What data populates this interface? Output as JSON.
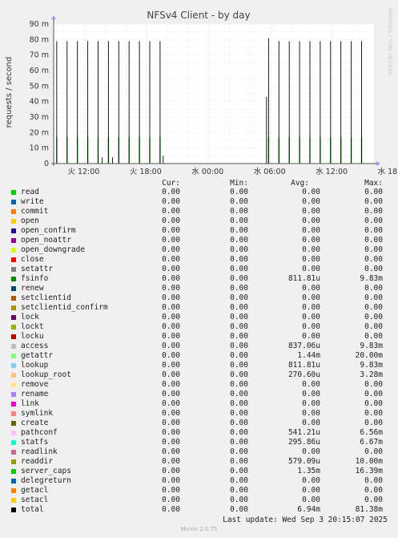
{
  "chart_data": {
    "type": "line",
    "title": "NFSv4 Client - by day",
    "ylabel": "requests / second",
    "side_label": "RRDTOOL / TOBI OETIKER",
    "ylim": [
      0,
      90
    ],
    "y_ticks": [
      "0",
      "10 m",
      "20 m",
      "30 m",
      "40 m",
      "50 m",
      "60 m",
      "70 m",
      "80 m",
      "90 m"
    ],
    "x_ticks": [
      "火 12:00",
      "火 18:00",
      "水 00:00",
      "水 06:00",
      "水 12:00",
      "水 18:00"
    ],
    "x_range_hours": [
      9,
      40
    ],
    "unit": "m",
    "spike_series": [
      {
        "name": "total",
        "color": "#000000",
        "values_m": [
          79,
          79,
          79,
          79,
          79,
          79,
          79,
          79,
          79,
          79,
          79
        ]
      },
      {
        "name": "getattr",
        "color": "#00cc00",
        "values_m": [
          17,
          17,
          17,
          17,
          17,
          17,
          17,
          17,
          17,
          17,
          17
        ]
      }
    ],
    "spike_times_h": [
      9.3,
      10.3,
      11.3,
      12.3,
      13.3,
      14.3,
      15.3,
      16.3,
      17.3,
      18.3,
      19.3,
      29.8,
      30.8,
      31.8,
      32.8,
      33.8,
      34.8,
      35.8,
      36.8,
      37.8,
      38.8
    ],
    "spike_totals_m": [
      79,
      79,
      79,
      79,
      79,
      79,
      79,
      79,
      79,
      79,
      79,
      81,
      79,
      79,
      79,
      79,
      79,
      79,
      79,
      79,
      79
    ],
    "small_spikes": [
      {
        "t": 13.7,
        "v": 4
      },
      {
        "t": 14.7,
        "v": 4
      },
      {
        "t": 19.6,
        "v": 5
      },
      {
        "t": 29.6,
        "v": 43
      }
    ]
  },
  "legend": {
    "headers": {
      "cur": "Cur:",
      "min": "Min:",
      "avg": "Avg:",
      "max": "Max:"
    },
    "rows": [
      {
        "name": "read",
        "color": "#00cc00",
        "cur": "0.00",
        "min": "0.00",
        "avg": "0.00",
        "max": "0.00"
      },
      {
        "name": "write",
        "color": "#0066b3",
        "cur": "0.00",
        "min": "0.00",
        "avg": "0.00",
        "max": "0.00"
      },
      {
        "name": "commit",
        "color": "#ff8000",
        "cur": "0.00",
        "min": "0.00",
        "avg": "0.00",
        "max": "0.00"
      },
      {
        "name": "open",
        "color": "#ffcc00",
        "cur": "0.00",
        "min": "0.00",
        "avg": "0.00",
        "max": "0.00"
      },
      {
        "name": "open_confirm",
        "color": "#330099",
        "cur": "0.00",
        "min": "0.00",
        "avg": "0.00",
        "max": "0.00"
      },
      {
        "name": "open_noattr",
        "color": "#990099",
        "cur": "0.00",
        "min": "0.00",
        "avg": "0.00",
        "max": "0.00"
      },
      {
        "name": "open_downgrade",
        "color": "#ccff00",
        "cur": "0.00",
        "min": "0.00",
        "avg": "0.00",
        "max": "0.00"
      },
      {
        "name": "close",
        "color": "#ff0000",
        "cur": "0.00",
        "min": "0.00",
        "avg": "0.00",
        "max": "0.00"
      },
      {
        "name": "setattr",
        "color": "#808080",
        "cur": "0.00",
        "min": "0.00",
        "avg": "0.00",
        "max": "0.00"
      },
      {
        "name": "fsinfo",
        "color": "#008f00",
        "cur": "0.00",
        "min": "0.00",
        "avg": "811.81u",
        "max": "9.83m"
      },
      {
        "name": "renew",
        "color": "#00487d",
        "cur": "0.00",
        "min": "0.00",
        "avg": "0.00",
        "max": "0.00"
      },
      {
        "name": "setclientid",
        "color": "#b35a00",
        "cur": "0.00",
        "min": "0.00",
        "avg": "0.00",
        "max": "0.00"
      },
      {
        "name": "setclientid_confirm",
        "color": "#b38f00",
        "cur": "0.00",
        "min": "0.00",
        "avg": "0.00",
        "max": "0.00"
      },
      {
        "name": "lock",
        "color": "#6b006b",
        "cur": "0.00",
        "min": "0.00",
        "avg": "0.00",
        "max": "0.00"
      },
      {
        "name": "lockt",
        "color": "#8fb300",
        "cur": "0.00",
        "min": "0.00",
        "avg": "0.00",
        "max": "0.00"
      },
      {
        "name": "locku",
        "color": "#b30000",
        "cur": "0.00",
        "min": "0.00",
        "avg": "0.00",
        "max": "0.00"
      },
      {
        "name": "access",
        "color": "#bebebe",
        "cur": "0.00",
        "min": "0.00",
        "avg": "837.06u",
        "max": "9.83m"
      },
      {
        "name": "getattr",
        "color": "#80ff80",
        "cur": "0.00",
        "min": "0.00",
        "avg": "1.44m",
        "max": "20.00m"
      },
      {
        "name": "lookup",
        "color": "#80c9ff",
        "cur": "0.00",
        "min": "0.00",
        "avg": "811.81u",
        "max": "9.83m"
      },
      {
        "name": "lookup_root",
        "color": "#ffc080",
        "cur": "0.00",
        "min": "0.00",
        "avg": "270.60u",
        "max": "3.28m"
      },
      {
        "name": "remove",
        "color": "#ffe680",
        "cur": "0.00",
        "min": "0.00",
        "avg": "0.00",
        "max": "0.00"
      },
      {
        "name": "rename",
        "color": "#aa80ff",
        "cur": "0.00",
        "min": "0.00",
        "avg": "0.00",
        "max": "0.00"
      },
      {
        "name": "link",
        "color": "#ee00cc",
        "cur": "0.00",
        "min": "0.00",
        "avg": "0.00",
        "max": "0.00"
      },
      {
        "name": "symlink",
        "color": "#ff8080",
        "cur": "0.00",
        "min": "0.00",
        "avg": "0.00",
        "max": "0.00"
      },
      {
        "name": "create",
        "color": "#666600",
        "cur": "0.00",
        "min": "0.00",
        "avg": "0.00",
        "max": "0.00"
      },
      {
        "name": "pathconf",
        "color": "#ffbfff",
        "cur": "0.00",
        "min": "0.00",
        "avg": "541.21u",
        "max": "6.56m"
      },
      {
        "name": "statfs",
        "color": "#00ffcc",
        "cur": "0.00",
        "min": "0.00",
        "avg": "295.86u",
        "max": "6.67m"
      },
      {
        "name": "readlink",
        "color": "#cc6699",
        "cur": "0.00",
        "min": "0.00",
        "avg": "0.00",
        "max": "0.00"
      },
      {
        "name": "readdir",
        "color": "#999900",
        "cur": "0.00",
        "min": "0.00",
        "avg": "579.09u",
        "max": "10.00m"
      },
      {
        "name": "server_caps",
        "color": "#00cc00",
        "cur": "0.00",
        "min": "0.00",
        "avg": "1.35m",
        "max": "16.39m"
      },
      {
        "name": "delegreturn",
        "color": "#0066b3",
        "cur": "0.00",
        "min": "0.00",
        "avg": "0.00",
        "max": "0.00"
      },
      {
        "name": "getacl",
        "color": "#ff8000",
        "cur": "0.00",
        "min": "0.00",
        "avg": "0.00",
        "max": "0.00"
      },
      {
        "name": "setacl",
        "color": "#ffcc00",
        "cur": "0.00",
        "min": "0.00",
        "avg": "0.00",
        "max": "0.00"
      },
      {
        "name": "total",
        "color": "#000000",
        "cur": "0.00",
        "min": "0.00",
        "avg": "6.94m",
        "max": "81.38m"
      }
    ]
  },
  "last_update": "Last update: Wed Sep  3 20:15:07 2025",
  "footer": "Munin 2.0.75"
}
